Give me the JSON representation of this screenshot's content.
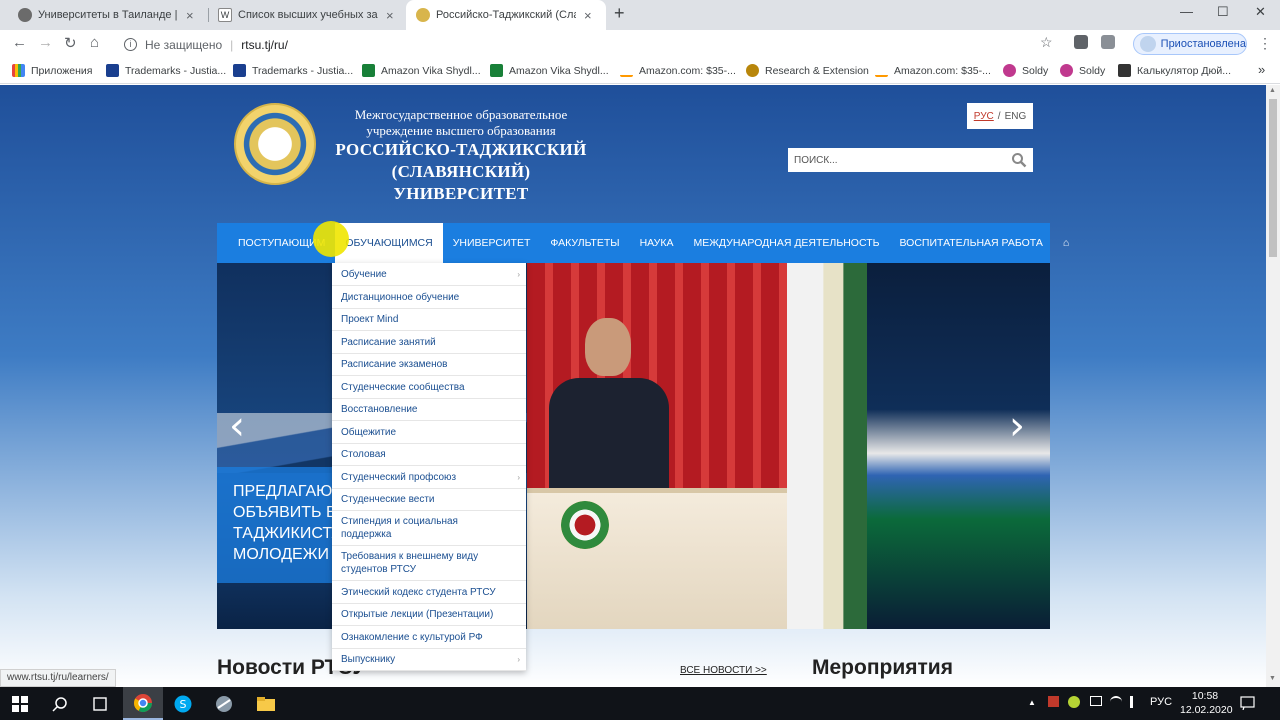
{
  "browser": {
    "tabs": [
      {
        "title": "Университеты в Таиланде | Всё...",
        "close": "×"
      },
      {
        "title": "Список высших учебных завед...",
        "close": "×"
      },
      {
        "title": "Российско-Таджикский (Славя...",
        "close": "×"
      }
    ],
    "new_tab": "+",
    "window_controls": {
      "minimize": "—",
      "maximize": "☐",
      "close": "✕"
    },
    "nav": {
      "back": "←",
      "forward": "→",
      "reload": "↻",
      "home": "⌂"
    },
    "omnibox": {
      "info": "i",
      "security": "Не защищено",
      "separator": "|",
      "url": "rtsu.tj/ru/"
    },
    "star": "☆",
    "paused_label": "Приостановлена",
    "menu": "⋮",
    "bookmarks": [
      {
        "label": "Приложения",
        "color": "#e8453c"
      },
      {
        "label": "Trademarks - Justia...",
        "color": "#1a3f8f"
      },
      {
        "label": "Trademarks - Justia...",
        "color": "#1a3f8f"
      },
      {
        "label": "Amazon Vika Shydl...",
        "color": "#188038"
      },
      {
        "label": "Amazon Vika Shydl...",
        "color": "#188038"
      },
      {
        "label": "Amazon.com: $35-...",
        "color": "#222222"
      },
      {
        "label": "Research & Extension",
        "color": "#b8860b"
      },
      {
        "label": "Amazon.com: $35-...",
        "color": "#222222"
      },
      {
        "label": "Soldy",
        "color": "#c0398e"
      },
      {
        "label": "Soldy",
        "color": "#c0398e"
      },
      {
        "label": "Калькулятор Дюй...",
        "color": "#333333"
      }
    ],
    "bookmarks_more": "»",
    "status_url": "www.rtsu.tj/ru/learners/"
  },
  "site": {
    "header": {
      "line1": "Межгосударственное образовательное",
      "line2": "учреждение высшего образования",
      "line3": "РОССИЙСКО-ТАДЖИКСКИЙ",
      "line4": "(СЛАВЯНСКИЙ) УНИВЕРСИТЕТ"
    },
    "lang": {
      "ru": "РУС",
      "sep": "/",
      "en": "ENG"
    },
    "search_placeholder": "ПОИСК...",
    "nav": [
      "ПОСТУПАЮЩИМ",
      "ОБУЧАЮЩИМСЯ",
      "УНИВЕРСИТЕТ",
      "ФАКУЛЬТЕТЫ",
      "НАУКА",
      "МЕЖДУНАРОДНАЯ ДЕЯТЕЛЬНОСТЬ",
      "ВОСПИТАТЕЛЬНАЯ РАБОТА",
      "⌂"
    ],
    "dropdown": [
      "Обучение",
      "Дистанционное обучение",
      "Проект Mind",
      "Расписание занятий",
      "Расписание экзаменов",
      "Студенческие сообщества",
      "Восстановление",
      "Общежитие",
      "Столовая",
      "Студенческий профсоюз",
      "Студенческие вести",
      "Стипендия и социальная поддержка",
      "Требования к внешнему виду студентов РТСУ",
      "Этический кодекс студента РТСУ",
      "Открытые лекции (Презентации)",
      "Ознакомление с культурой РФ",
      "Выпускнику"
    ],
    "slider": {
      "caption": "ПРЕДЛАГАЮ\nОБЪЯВИТЬ В\nТАДЖИКИСТА\nМОЛОДЕЖИ",
      "prev": "‹",
      "next": "›",
      "dot_count": 16,
      "active_dot": 4
    },
    "news_title": "Новости РТСУ",
    "all_news": "ВСЕ НОВОСТИ >>",
    "events_title": "Мероприятия"
  },
  "taskbar": {
    "tray": {
      "expand": "▲",
      "lang": "РУС"
    },
    "time": "10:58",
    "date": "12.02.2020"
  }
}
